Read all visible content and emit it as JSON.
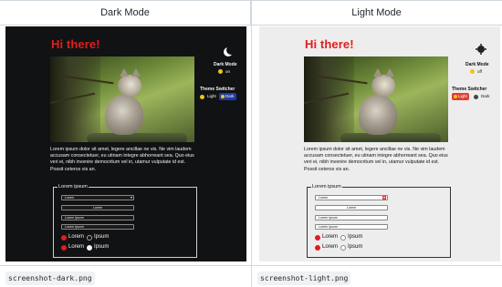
{
  "headers": {
    "dark": "Dark Mode",
    "light": "Light Mode"
  },
  "files": {
    "dark": "screenshot-dark.png",
    "light": "screenshot-light.png"
  },
  "app": {
    "greeting": "Hi there!",
    "dark_mode_title": "Dark Mode",
    "dark_mode_value": "on",
    "dark_mode_value_light": "off",
    "theme_switcher_title": "Theme Switcher",
    "switch_light": "Light",
    "switch_dark": "Dark",
    "paragraph": "Lorem ipsum dolor sit amet, legere ancillae ne vis. Ne vim laudem accusam consectetuer, eu utinam integre abhorreant sea. Quo eius veri ei, nibh invenire democritum vel in, utamur vulputate id est. Possit ceteros vis an.",
    "fieldset_legend": "Lorem ipsum",
    "select_value": "Lorem",
    "button_label": "Lorem",
    "input1_value": "Lorem ipsum",
    "input2_value": "Lorem ipsum",
    "radio1_a": "Lorem",
    "radio1_b": "Ipsum",
    "radio2_a": "Lorem",
    "radio2_b": "Ipsum"
  },
  "colors": {
    "accent_red": "#e11d1d",
    "dark_bg": "#111213",
    "light_bg": "#ededed",
    "switch_dark_active": "#1f3aa6",
    "switch_light_active": "#e03c31"
  }
}
